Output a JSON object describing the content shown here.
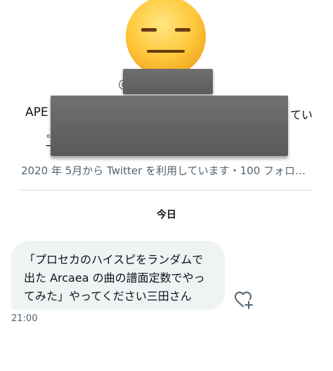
{
  "profile": {
    "handle_prefix": "@",
    "bio_start": "APE",
    "bio_end": "てい",
    "bio_fragment_1": "。",
    "bio_fragment_2": "ー",
    "joined_text": "2020 年 5月から Twitter を利用しています・100 フォロ…"
  },
  "conversation": {
    "date_separator": "今日",
    "messages": [
      {
        "lines": [
          "「プロセカのハイスピをランダムで",
          "出た Arcaea の曲の譜面定数でやっ",
          "てみた」やってください三田さん"
        ],
        "time": "21:00"
      }
    ]
  },
  "icons": {
    "avatar": "expressionless-face-emoji",
    "reaction": "heart-plus-icon"
  },
  "colors": {
    "bubble_bg": "#eff3f4",
    "secondary_text": "#536471",
    "divider": "#cfd9de",
    "redaction": "#646464"
  }
}
